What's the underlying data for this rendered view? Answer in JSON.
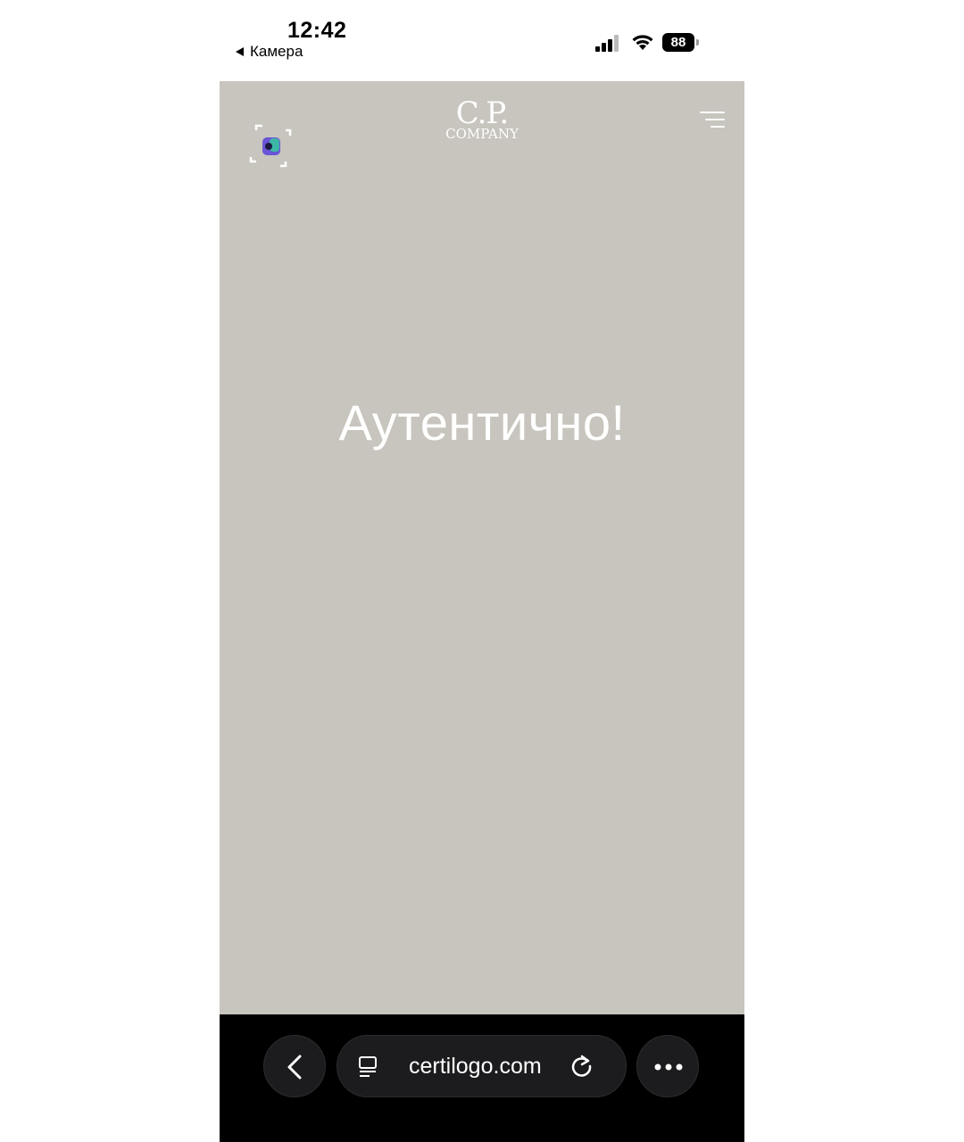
{
  "status_bar": {
    "time": "12:42",
    "back_app": "Камера",
    "battery": "88"
  },
  "header": {
    "brand_line1": "C.P.",
    "brand_line2": "COMPANY"
  },
  "main": {
    "result": "Аутентично!"
  },
  "browser": {
    "url": "certilogo.com"
  },
  "colors": {
    "background": "#c8c5be",
    "browser_bar": "#000000",
    "text": "#ffffff"
  }
}
